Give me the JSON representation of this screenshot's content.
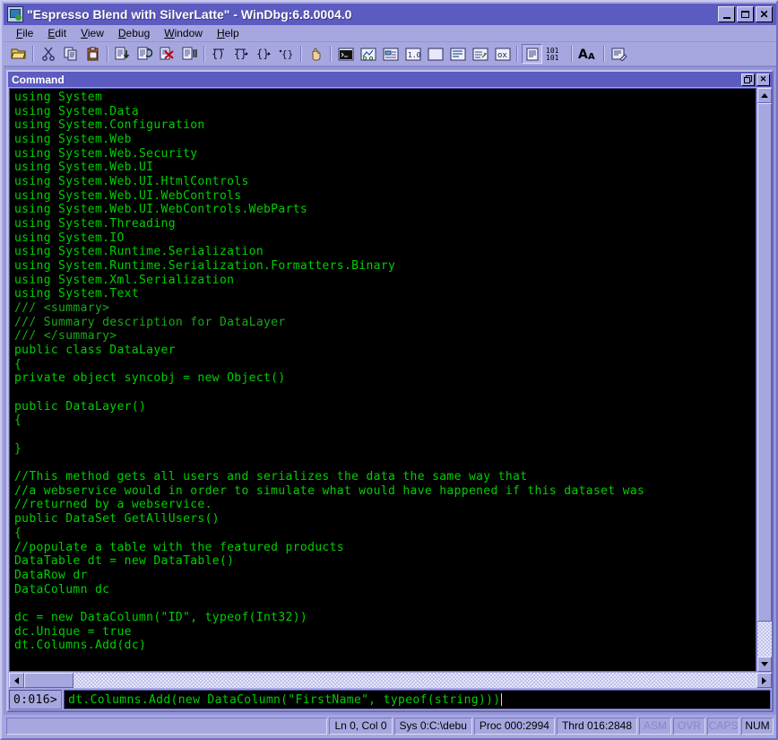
{
  "window": {
    "title": "\"Espresso Blend with SilverLatte\" - WinDbg:6.8.0004.0",
    "icon": "windbg-icon",
    "buttons": {
      "minimize": "_",
      "maximize": "□",
      "close": "✕"
    }
  },
  "menu": {
    "items": [
      {
        "name": "file",
        "label": "File",
        "accel": "F"
      },
      {
        "name": "edit",
        "label": "Edit",
        "accel": "E"
      },
      {
        "name": "view",
        "label": "View",
        "accel": "V"
      },
      {
        "name": "debug",
        "label": "Debug",
        "accel": "D"
      },
      {
        "name": "window",
        "label": "Window",
        "accel": "W"
      },
      {
        "name": "help",
        "label": "Help",
        "accel": "H"
      }
    ]
  },
  "toolbar": {
    "groups": [
      {
        "tools": [
          {
            "name": "open-file-icon",
            "glyph": "open-folder"
          }
        ]
      },
      {
        "tools": [
          {
            "name": "cut-icon",
            "glyph": "scissors"
          },
          {
            "name": "copy-icon",
            "glyph": "copy"
          },
          {
            "name": "paste-icon",
            "glyph": "paste"
          }
        ]
      },
      {
        "tools": [
          {
            "name": "go-icon",
            "glyph": "doc-down"
          },
          {
            "name": "restart-icon",
            "glyph": "doc-restart"
          },
          {
            "name": "stop-debugging-icon",
            "glyph": "doc-x"
          },
          {
            "name": "break-icon",
            "glyph": "doc-bar"
          }
        ]
      },
      {
        "tools": [
          {
            "name": "step-into-icon",
            "glyph": "brace-into"
          },
          {
            "name": "step-over-icon",
            "glyph": "brace-over"
          },
          {
            "name": "step-out-icon",
            "glyph": "brace-out"
          },
          {
            "name": "run-to-cursor-icon",
            "glyph": "brace-cursor"
          }
        ]
      },
      {
        "tools": [
          {
            "name": "break-hand-icon",
            "glyph": "hand"
          }
        ]
      },
      {
        "tools": [
          {
            "name": "command-window-icon",
            "glyph": "console"
          },
          {
            "name": "watch-window-icon",
            "glyph": "watch"
          },
          {
            "name": "locals-window-icon",
            "glyph": "locals"
          },
          {
            "name": "registers-window-icon",
            "glyph": "registers"
          },
          {
            "name": "memory-window-icon",
            "glyph": "memory"
          },
          {
            "name": "call-stack-window-icon",
            "glyph": "callstack"
          },
          {
            "name": "disassembly-window-icon",
            "glyph": "disasm"
          },
          {
            "name": "scratch-pad-icon",
            "glyph": "scratch"
          },
          {
            "name": "processes-threads-icon",
            "glyph": "procthread"
          }
        ]
      },
      {
        "tools": [
          {
            "name": "source-mode-icon",
            "glyph": "source-mode"
          },
          {
            "name": "asm-mode-icon",
            "glyph": "101101"
          },
          {
            "name": "font-icon",
            "glyph": "AA"
          }
        ]
      },
      {
        "tools": [
          {
            "name": "options-icon",
            "glyph": "options"
          }
        ]
      }
    ]
  },
  "command_window": {
    "title": "Command",
    "restore_label": "⧉",
    "close_label": "✕",
    "lines": [
      {
        "text": "using System",
        "style": "code"
      },
      {
        "text": "using System.Data",
        "style": "code"
      },
      {
        "text": "using System.Configuration",
        "style": "code"
      },
      {
        "text": "using System.Web",
        "style": "code"
      },
      {
        "text": "using System.Web.Security",
        "style": "code"
      },
      {
        "text": "using System.Web.UI",
        "style": "code"
      },
      {
        "text": "using System.Web.UI.HtmlControls",
        "style": "code"
      },
      {
        "text": "using System.Web.UI.WebControls",
        "style": "code"
      },
      {
        "text": "using System.Web.UI.WebControls.WebParts",
        "style": "code"
      },
      {
        "text": "using System.Threading",
        "style": "code"
      },
      {
        "text": "using System.IO",
        "style": "code"
      },
      {
        "text": "using System.Runtime.Serialization",
        "style": "code"
      },
      {
        "text": "using System.Runtime.Serialization.Formatters.Binary",
        "style": "code"
      },
      {
        "text": "using System.Xml.Serialization",
        "style": "code"
      },
      {
        "text": "using System.Text",
        "style": "code"
      },
      {
        "text": "/// <summary>",
        "style": "comment"
      },
      {
        "text": "/// Summary description for DataLayer",
        "style": "comment"
      },
      {
        "text": "/// </summary>",
        "style": "comment"
      },
      {
        "text": "public class DataLayer",
        "style": "code"
      },
      {
        "text": "{",
        "style": "code"
      },
      {
        "text": "private object syncobj = new Object()",
        "style": "code"
      },
      {
        "text": "",
        "style": "code"
      },
      {
        "text": "public DataLayer()",
        "style": "code"
      },
      {
        "text": "{",
        "style": "code"
      },
      {
        "text": "",
        "style": "code"
      },
      {
        "text": "}",
        "style": "code"
      },
      {
        "text": "",
        "style": "code"
      },
      {
        "text": "//This method gets all users and serializes the data the same way that",
        "style": "code"
      },
      {
        "text": "//a webservice would in order to simulate what would have happened if this dataset was",
        "style": "code"
      },
      {
        "text": "//returned by a webservice.",
        "style": "code"
      },
      {
        "text": "public DataSet GetAllUsers()",
        "style": "code"
      },
      {
        "text": "{",
        "style": "code"
      },
      {
        "text": "//populate a table with the featured products",
        "style": "code"
      },
      {
        "text": "DataTable dt = new DataTable()",
        "style": "code"
      },
      {
        "text": "DataRow dr",
        "style": "code"
      },
      {
        "text": "DataColumn dc",
        "style": "code"
      },
      {
        "text": "",
        "style": "code"
      },
      {
        "text": "dc = new DataColumn(\"ID\", typeof(Int32))",
        "style": "code"
      },
      {
        "text": "dc.Unique = true",
        "style": "code"
      },
      {
        "text": "dt.Columns.Add(dc)",
        "style": "code"
      }
    ]
  },
  "prompt": {
    "label": "0:016>",
    "value": "dt.Columns.Add(new DataColumn(\"FirstName\", typeof(string)))",
    "placeholder": ""
  },
  "statusbar": {
    "message": "",
    "cells": [
      {
        "name": "cursor-position",
        "label": "Ln 0, Col 0",
        "dim": false
      },
      {
        "name": "system-path",
        "label": "Sys 0:C:\\debu",
        "dim": false
      },
      {
        "name": "process-id",
        "label": "Proc 000:2994",
        "dim": false
      },
      {
        "name": "thread-id",
        "label": "Thrd 016:2848",
        "dim": false
      },
      {
        "name": "asm-indicator",
        "label": "ASM",
        "dim": true
      },
      {
        "name": "ovr-indicator",
        "label": "OVR",
        "dim": true
      },
      {
        "name": "caps-indicator",
        "label": "CAPS",
        "dim": true
      },
      {
        "name": "num-indicator",
        "label": "NUM",
        "dim": false
      }
    ]
  },
  "colors": {
    "title_active": "#5b5bc0",
    "face": "#a7a7e0",
    "code_bg": "#000000",
    "code_fg": "#00d000",
    "comment_fg": "#1aa81a"
  }
}
